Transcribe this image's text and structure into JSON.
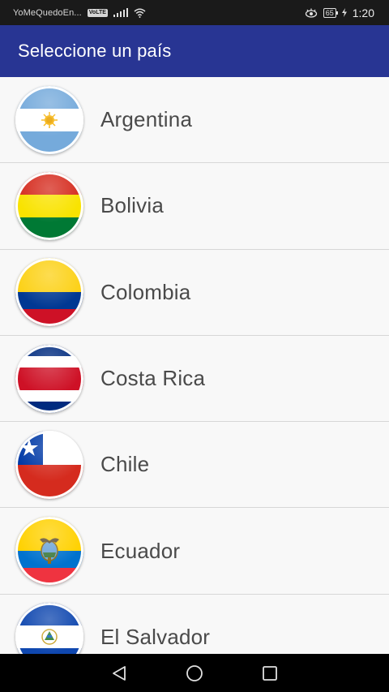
{
  "status_bar": {
    "app_name": "YoMeQuedoEn...",
    "volte": "VoLTE",
    "battery": "65",
    "time": "1:20"
  },
  "app_bar": {
    "title": "Seleccione un país",
    "color": "#283593"
  },
  "countries": [
    {
      "name": "Argentina",
      "flag_icon": "argentina-flag-icon"
    },
    {
      "name": "Bolivia",
      "flag_icon": "bolivia-flag-icon"
    },
    {
      "name": "Colombia",
      "flag_icon": "colombia-flag-icon"
    },
    {
      "name": "Costa Rica",
      "flag_icon": "costa-rica-flag-icon"
    },
    {
      "name": "Chile",
      "flag_icon": "chile-flag-icon"
    },
    {
      "name": "Ecuador",
      "flag_icon": "ecuador-flag-icon"
    },
    {
      "name": "El Salvador",
      "flag_icon": "el-salvador-flag-icon"
    }
  ],
  "nav_bar": {
    "back_icon": "back-triangle-icon",
    "home_icon": "home-circle-icon",
    "recents_icon": "recents-square-icon"
  }
}
